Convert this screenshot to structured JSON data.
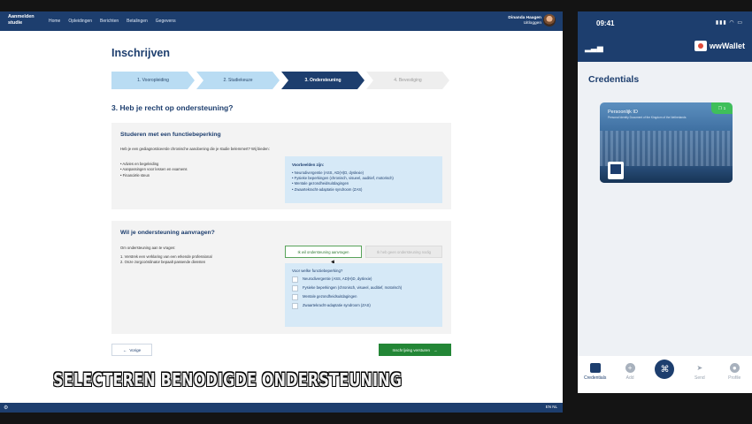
{
  "web": {
    "brand": "Aanmelden studie",
    "nav": [
      "Home",
      "Opleidingen",
      "Berichten",
      "Betalingen",
      "Gegevens"
    ],
    "user": {
      "name": "Dinanda Haagen",
      "role": "Uitloggen"
    },
    "page_title": "Inschrijven",
    "steps": [
      {
        "label": "1. Vooropleiding",
        "state": "done"
      },
      {
        "label": "2. Studiekeuze",
        "state": "done"
      },
      {
        "label": "3. Ondersteuning",
        "state": "active"
      },
      {
        "label": "4. Bevestiging",
        "state": "todo"
      }
    ],
    "section_title": "3. Heb je recht op ondersteuning?",
    "card1": {
      "title": "Studeren met een functiebeperking",
      "intro": "Heb je een gediagnosticeerde chronische aandoening die je studie belemmert? Wij bieden:",
      "bullets": [
        "Advies en begeleiding",
        "Aanpassingen voor lessen en examens",
        "Financiële steun"
      ],
      "examples_title": "Voorbeelden zijn:",
      "examples": [
        "Neurodivergentie (ASS, AD(H)D, dyslexie)",
        "Fysieke beperkingen (chronisch, visueel, auditief, motorisch)",
        "Mentale gezondheidsuitdagingen",
        "Zwaartekracht-adaptatie syndroom (ZAS)"
      ]
    },
    "card2": {
      "title": "Wil je ondersteuning aanvragen?",
      "intro": "Om ondersteuning aan te vragen:",
      "steps": [
        "1. Verstrek een verklaring van een erkende professional",
        "2. Onze zorgcoördinator bepaalt passende diensten"
      ],
      "choice_yes": "Ik wil ondersteuning aanvragen",
      "choice_no": "Ik heb geen ondersteuning nodig",
      "question": "Voor welke functiebeperking?",
      "options": [
        "Neurodivergentie (ASS, AD(H)D, dyslexie)",
        "Fysieke beperkingen (chronisch, visueel, auditief, motorisch)",
        "Mentale gezondheidsuitdagingen",
        "Zwaartekracht-adaptatie syndroom (ZAS)"
      ]
    },
    "btn_prev": "Vorige",
    "btn_next": "Inschrijving versturen",
    "lang": "EN NL"
  },
  "caption": "SELECTEREN BENODIGDE ONDERSTEUNING",
  "phone": {
    "time": "09:41",
    "app_name": "wwWallet",
    "title": "Credentials",
    "card": {
      "name": "Persoonlijk ID",
      "subtitle": "Personal Identity Document of the Kingdom of the Netherlands",
      "badge": "1"
    },
    "tabs": [
      {
        "label": "Credentials",
        "icon": "wallet-icon"
      },
      {
        "label": "Add",
        "icon": "plus-icon"
      },
      {
        "label": "",
        "icon": "qr-scan-icon"
      },
      {
        "label": "Send",
        "icon": "send-icon"
      },
      {
        "label": "Profile",
        "icon": "profile-icon"
      }
    ]
  },
  "colors": {
    "brand": "#1d3e6e",
    "step_done": "#b9dcf3",
    "info_bg": "#d6e9f7",
    "success": "#238636"
  }
}
